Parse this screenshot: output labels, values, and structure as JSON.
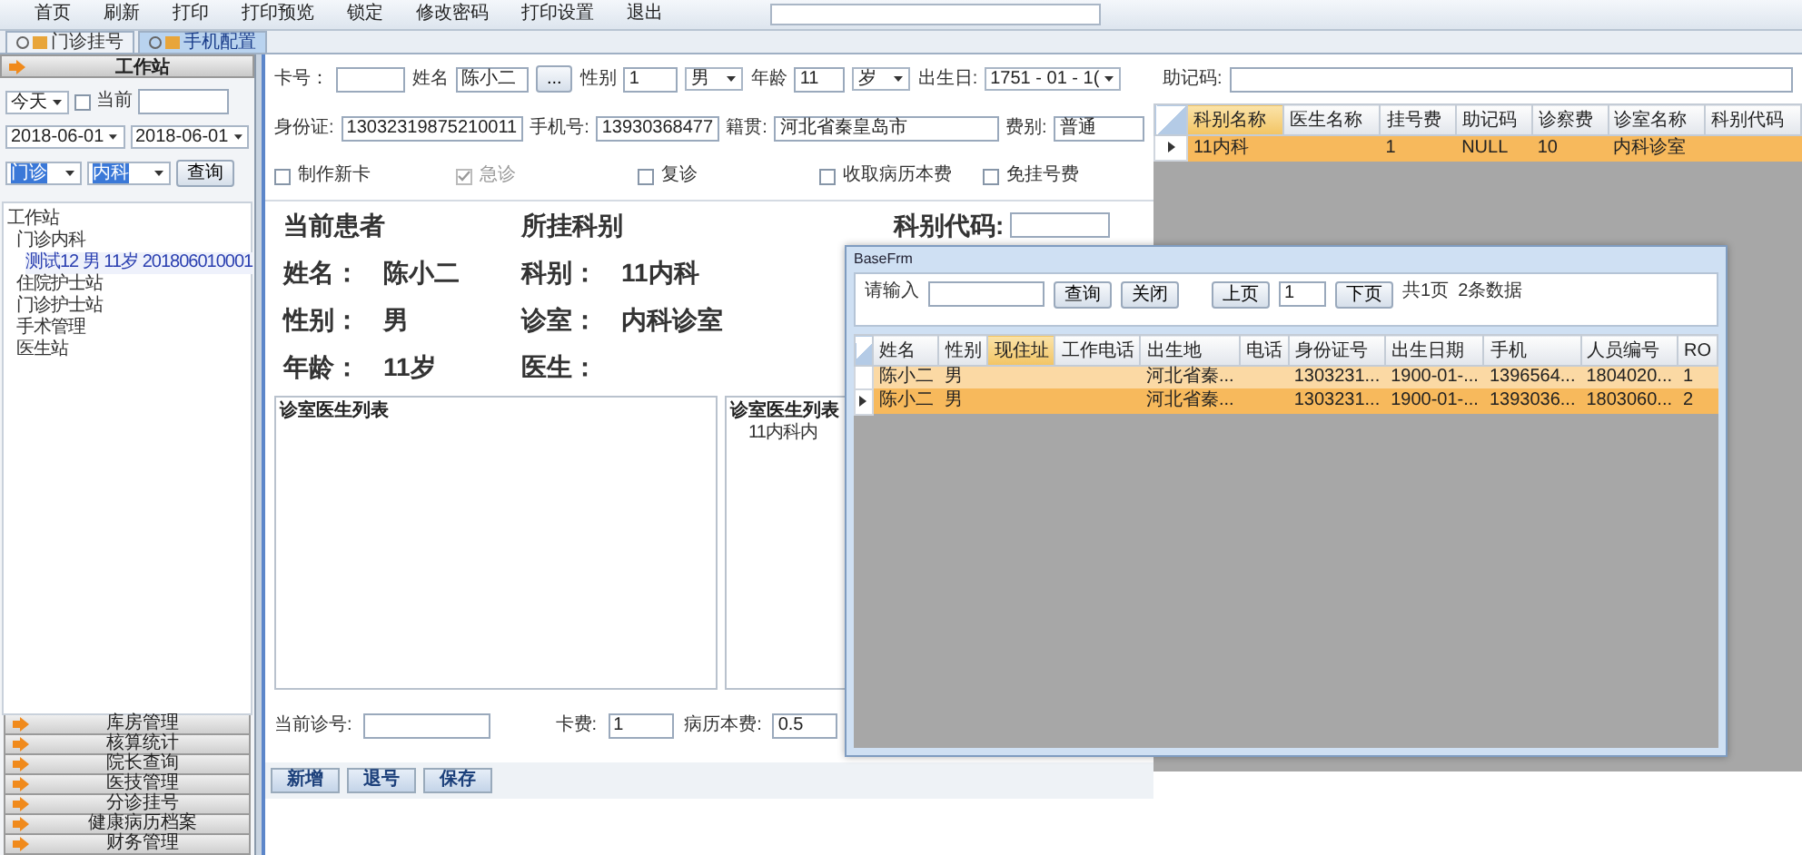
{
  "menu": [
    "首页",
    "刷新",
    "打印",
    "打印预览",
    "锁定",
    "修改密码",
    "打印设置",
    "退出"
  ],
  "tabs": [
    {
      "label": "门诊挂号",
      "selected": false
    },
    {
      "label": "手机配置",
      "selected": true
    }
  ],
  "sidebar": {
    "title": "工作站",
    "period": "今天",
    "current": {
      "label": "当前",
      "checked": false
    },
    "date_from": "2018-06-01",
    "date_to": "2018-06-01",
    "type": "门诊",
    "dept": "内科",
    "query_button": "查询",
    "tree": {
      "label": "工作站",
      "children": [
        {
          "label": "门诊内科",
          "children": [
            {
              "label": "测试12 男 11岁 201806010001",
              "selected": true
            }
          ]
        },
        {
          "label": "住院护士站"
        },
        {
          "label": "门诊护士站"
        },
        {
          "label": "手术管理"
        },
        {
          "label": "医生站"
        }
      ]
    },
    "modules": [
      "库房管理",
      "核算统计",
      "院长查询",
      "医技管理",
      "分诊挂号",
      "健康病历档案",
      "财务管理"
    ]
  },
  "form": {
    "card_label": "卡号：",
    "name_label": "姓名",
    "name_value": "陈小二",
    "browse_button": "...",
    "sex_label": "性别",
    "sex_code": "1",
    "sex_value": "男",
    "age_label": "年龄",
    "age_value": "11",
    "age_unit": "岁",
    "birth_label": "出生日:",
    "birth_value": "1751 - 01 - 1(",
    "id_label": "身份证:",
    "id_value": "13032319875210011",
    "phone_label": "手机号:",
    "phone_value": "13930368477",
    "origin_label": "籍贯:",
    "origin_value": "河北省秦皇岛市",
    "fee_label": "费别:",
    "fee_value": "普通",
    "checkboxes": [
      {
        "label": "制作新卡",
        "checked": false,
        "disabled": false
      },
      {
        "label": "急诊",
        "checked": true,
        "disabled": true
      },
      {
        "label": "复诊",
        "checked": false,
        "disabled": false
      },
      {
        "label": "收取病历本费",
        "checked": false,
        "disabled": false
      },
      {
        "label": "免挂号费",
        "checked": false,
        "disabled": false
      }
    ]
  },
  "summary": {
    "patient_heading": "当前患者",
    "dept_heading": "所挂科别",
    "code_label": "科别代码:",
    "rows": [
      {
        "label_1": "姓名：",
        "value_1": "陈小二",
        "label_2": "科别：",
        "value_2": "11内科"
      },
      {
        "label_1": "性别：",
        "value_1": "男",
        "label_2": "诊室：",
        "value_2": "内科诊室"
      },
      {
        "label_1": "年龄：",
        "value_1": "11岁",
        "label_2": "医生："
      }
    ]
  },
  "doctor_panels": [
    {
      "title": "诊室医生列表"
    },
    {
      "title": "诊室医生列表",
      "items": [
        "11内科内"
      ]
    }
  ],
  "bottom": {
    "number_label": "当前诊号:",
    "card_fee_label": "卡费:",
    "card_fee_value": "1",
    "book_fee_label": "病历本费:",
    "book_fee_value": "0.5"
  },
  "actions": [
    "新增",
    "退号",
    "保存"
  ],
  "mnemonic": {
    "label": "助记码:"
  },
  "dept_grid": {
    "columns": [
      {
        "label": "科别名称",
        "highlighted": true
      },
      {
        "label": "医生名称",
        "highlighted": false
      },
      {
        "label": "挂号费",
        "highlighted": false
      },
      {
        "label": "助记码",
        "highlighted": false
      },
      {
        "label": "诊察费",
        "highlighted": false
      },
      {
        "label": "诊室名称",
        "highlighted": false
      },
      {
        "label": "科别代码",
        "highlighted": false
      }
    ],
    "rows": [
      {
        "selected": true,
        "cells": [
          "11内科",
          "",
          "1",
          "NULL",
          "10",
          "内科诊室",
          ""
        ]
      }
    ]
  },
  "popup": {
    "title": "BaseFrm",
    "input_label": "请输入",
    "query_button": "查询",
    "close_button": "关闭",
    "prev_button": "上页",
    "page": "1",
    "next_button": "下页",
    "page_count": "共1页",
    "record_count": "2条数据",
    "columns": [
      {
        "label": "姓名",
        "highlighted": false
      },
      {
        "label": "性别",
        "highlighted": false
      },
      {
        "label": "现住址",
        "highlighted": true
      },
      {
        "label": "工作电话",
        "highlighted": false
      },
      {
        "label": "出生地",
        "highlighted": false
      },
      {
        "label": "电话",
        "highlighted": false
      },
      {
        "label": "身份证号",
        "highlighted": false
      },
      {
        "label": "出生日期",
        "highlighted": false
      },
      {
        "label": "手机",
        "highlighted": false
      },
      {
        "label": "人员编号",
        "highlighted": false
      },
      {
        "label": "RO",
        "highlighted": false
      }
    ],
    "rows": [
      {
        "selected": false,
        "cells": [
          "陈小二",
          "男",
          "",
          "",
          "河北省秦...",
          "",
          "1303231...",
          "1900-01-...",
          "1396564...",
          "1804020...",
          "1"
        ]
      },
      {
        "selected": true,
        "cells": [
          "陈小二",
          "男",
          "",
          "",
          "河北省秦...",
          "",
          "1303231...",
          "1900-01-...",
          "1393036...",
          "1803060...",
          "2"
        ]
      }
    ]
  }
}
